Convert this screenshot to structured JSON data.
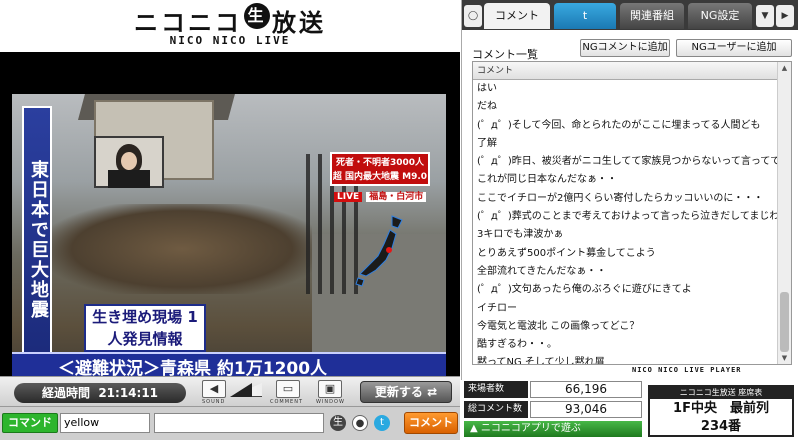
{
  "logo": {
    "main_left": "ニコニコ",
    "main_badge": "生",
    "main_right": "放送",
    "sub": "NICO NICO LIVE"
  },
  "video": {
    "side_caption": "東日本で巨大地震",
    "headline_red": "死者・不明者3000人超 国内最大地震 M9.0",
    "live_label": "LIVE",
    "live_location": "福島・白河市",
    "caption_box": "生き埋め現場 1人発見情報",
    "ticker": "＜避難状況＞青森県 約1万1200人"
  },
  "controls": {
    "elapsed_label": "経過時間",
    "elapsed_time": "21:14:11",
    "sound_label": "SOUND",
    "comment_label": "COMMENT",
    "window_label": "WINDOW",
    "refresh_label": "更新する",
    "volume_level": 0.7
  },
  "cmdbar": {
    "command_label": "コマンド",
    "command_value": "yellow",
    "comment_button": "コメント"
  },
  "tabs": [
    {
      "label": "コメント"
    },
    {
      "label": "t"
    },
    {
      "label": "関連番組"
    },
    {
      "label": "NG設定"
    },
    {
      "label": "▼"
    }
  ],
  "comments": {
    "list_title": "コメント一覧",
    "ng_comment_button": "NGコメントに追加",
    "ng_user_button": "NGユーザーに追加",
    "column_header": "コメント",
    "rows": [
      "はい",
      "だね",
      "(゜д゜)そして今回、命とられたのがここに埋まってる人間ども",
      "了解",
      "(゜д゜)昨日、被災者がニコ生してて家族見つからないって言ってて",
      "これが同じ日本なんだなぁ・・",
      "ここでイチローが2億円くらい寄付したらカッコいいのに・・・",
      "(゜д゜)葬式のことまで考えておけよって言ったら泣きだしてまじわろす",
      "3キロでも津波かぁ",
      "とりあえず500ポイント募金してこよう",
      "全部流れてきたんだなぁ・・",
      "(゜д゜)文句あったら俺のぶろぐに遊びにきてよ",
      "イチロー",
      "今電気と電波北 この画像ってどこ？",
      "酷すぎるわ・・。",
      "黙ってNG そして少し黙れ屑"
    ],
    "player_tag": "NICO NICO LIVE PLAYER"
  },
  "stats": {
    "visitors_label": "来場者数",
    "visitors_value": "66,196",
    "comments_label": "総コメント数",
    "comments_value": "93,046",
    "play_app": "ニコニコアプリで遊ぶ"
  },
  "seat": {
    "title": "ニコニコ生放送 座席表",
    "row": "1F中央　最前列",
    "number": "234番"
  },
  "colors": {
    "ticker_blue": "#1f2f98",
    "red_headline": "#c10d0d",
    "command_green": "#2db52d",
    "comment_orange": "#ff9a30"
  }
}
